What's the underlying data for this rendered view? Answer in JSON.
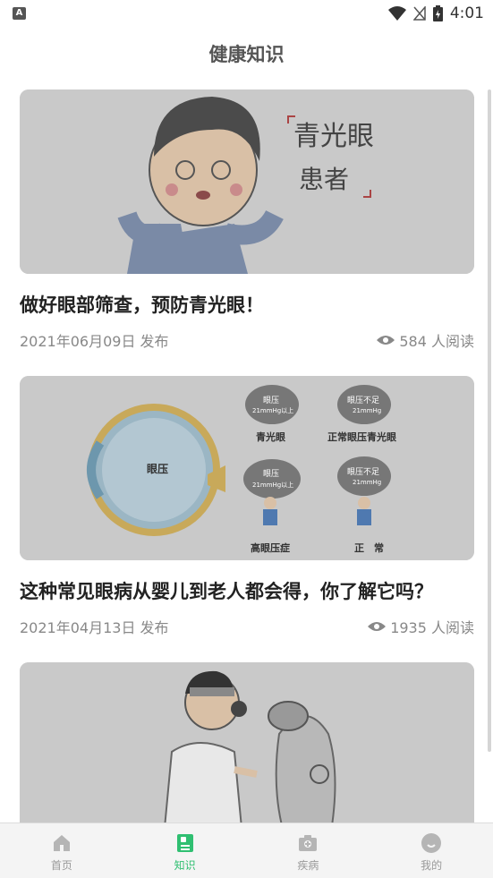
{
  "status_bar": {
    "time": "4:01",
    "notification_badge": "A"
  },
  "header": {
    "title": "健康知识"
  },
  "articles": [
    {
      "title": "做好眼部筛查，预防青光眼！",
      "date": "2021年06月09日 发布",
      "views": "584 人阅读",
      "image_text": {
        "line1": "青光眼",
        "line2": "患者"
      }
    },
    {
      "title": "这种常见眼病从婴儿到老人都会得，你了解它吗？",
      "date": "2021年04月13日 发布",
      "views": "1935 人阅读",
      "image_text": {
        "eye_label": "眼压",
        "rock1": "眼压",
        "rock1_sub": "21mmHg以上",
        "caption1": "青光眼",
        "rock2": "眼压不足",
        "rock2_sub": "21mmHg",
        "caption2": "正常眼压青光眼",
        "rock3": "眼压",
        "rock3_sub": "21mmHg以上",
        "caption3": "高眼压症",
        "rock4": "眼压不足",
        "rock4_sub": "21mmHg",
        "caption4": "正　常"
      }
    },
    {
      "title": "",
      "date": "",
      "views": ""
    }
  ],
  "tabs": [
    {
      "label": "首页",
      "icon": "home-icon",
      "active": false
    },
    {
      "label": "知识",
      "icon": "knowledge-icon",
      "active": true
    },
    {
      "label": "疾病",
      "icon": "disease-icon",
      "active": false
    },
    {
      "label": "我的",
      "icon": "profile-icon",
      "active": false
    }
  ],
  "colors": {
    "accent": "#2fbf71",
    "tab_inactive": "#999999",
    "image_overlay": "#c9c9c9"
  }
}
